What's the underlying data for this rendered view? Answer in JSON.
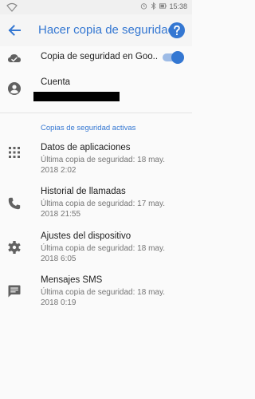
{
  "status_bar": {
    "time": "15:38",
    "left_icon": "wifi-icon",
    "right_icons": [
      "alarm-icon",
      "bluetooth-icon",
      "battery-icon"
    ]
  },
  "app_bar": {
    "back_icon": "arrow-back-icon",
    "title": "Hacer copia de seguridad",
    "help_icon": "help-icon"
  },
  "backup_toggle": {
    "icon": "cloud-check-icon",
    "label": "Copia de seguridad en Goo..",
    "enabled": true
  },
  "account": {
    "icon": "account-icon",
    "label": "Cuenta"
  },
  "section_header": "Copias de seguridad activas",
  "items": [
    {
      "icon": "apps-grid-icon",
      "title": "Datos de aplicaciones",
      "subtitle": "Última copia de seguridad: 18 may. 2018 2:02"
    },
    {
      "icon": "phone-icon",
      "title": "Historial de llamadas",
      "subtitle": "Última copia de seguridad: 17 may. 2018 21:55"
    },
    {
      "icon": "gear-icon",
      "title": "Ajustes del dispositivo",
      "subtitle": "Última copia de seguridad: 18 may. 2018 6:05"
    },
    {
      "icon": "message-icon",
      "title": "Mensajes SMS",
      "subtitle": "Última copia de seguridad: 18 may. 2018 0:19"
    }
  ],
  "colors": {
    "accent": "#3477d2",
    "toggle_track": "#9dbbe6",
    "icon_gray": "#616161",
    "subtitle": "#757575"
  }
}
